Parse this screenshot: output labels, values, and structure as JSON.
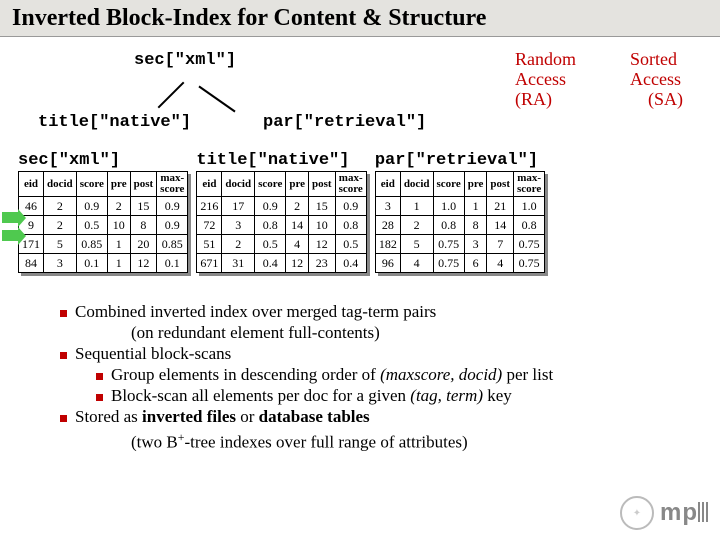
{
  "title": "Inverted Block-Index for Content & Structure",
  "tree": {
    "root": "sec[\"xml\"]",
    "left": "title[\"native\"]",
    "right": "par[\"retrieval\"]"
  },
  "access_labels": {
    "ra": "Random Access (RA)",
    "sa": "Sorted Access       (SA)"
  },
  "columns": [
    "eid",
    "docid",
    "score",
    "pre",
    "post",
    "max-\nscore"
  ],
  "tables": [
    {
      "header": "sec[\"xml\"]",
      "rows": [
        [
          "46",
          "2",
          "0.9",
          "2",
          "15",
          "0.9"
        ],
        [
          "9",
          "2",
          "0.5",
          "10",
          "8",
          "0.9"
        ],
        [
          "171",
          "5",
          "0.85",
          "1",
          "20",
          "0.85"
        ],
        [
          "84",
          "3",
          "0.1",
          "1",
          "12",
          "0.1"
        ]
      ]
    },
    {
      "header": "title[\"native\"]",
      "rows": [
        [
          "216",
          "17",
          "0.9",
          "2",
          "15",
          "0.9"
        ],
        [
          "72",
          "3",
          "0.8",
          "14",
          "10",
          "0.8"
        ],
        [
          "51",
          "2",
          "0.5",
          "4",
          "12",
          "0.5"
        ],
        [
          "671",
          "31",
          "0.4",
          "12",
          "23",
          "0.4"
        ]
      ]
    },
    {
      "header": "par[\"retrieval\"]",
      "rows": [
        [
          "3",
          "1",
          "1.0",
          "1",
          "21",
          "1.0"
        ],
        [
          "28",
          "2",
          "0.8",
          "8",
          "14",
          "0.8"
        ],
        [
          "182",
          "5",
          "0.75",
          "3",
          "7",
          "0.75"
        ],
        [
          "96",
          "4",
          "0.75",
          "6",
          "4",
          "0.75"
        ]
      ]
    }
  ],
  "bullets": [
    {
      "text": "Combined inverted index over merged tag-term pairs",
      "indent": 0
    },
    {
      "text": "(on redundant element full-contents)",
      "indent": 1,
      "nobullet": true
    },
    {
      "text": "Sequential block-scans",
      "indent": 0
    },
    {
      "text": "Group elements in descending order of (maxscore, docid) per list",
      "indent": 1,
      "italic_part": "(maxscore, docid)"
    },
    {
      "text": "Block-scan all elements per doc for a given (tag, term) key",
      "indent": 1,
      "italic_part": "(tag, term)"
    },
    {
      "text": "Stored as inverted files or database tables",
      "indent": 0
    },
    {
      "text": "(two B+-tree indexes over full range of attributes)",
      "indent": 1,
      "nobullet": true,
      "sup": true
    }
  ],
  "logo": {
    "seal": "MPG",
    "text": "mpii"
  }
}
